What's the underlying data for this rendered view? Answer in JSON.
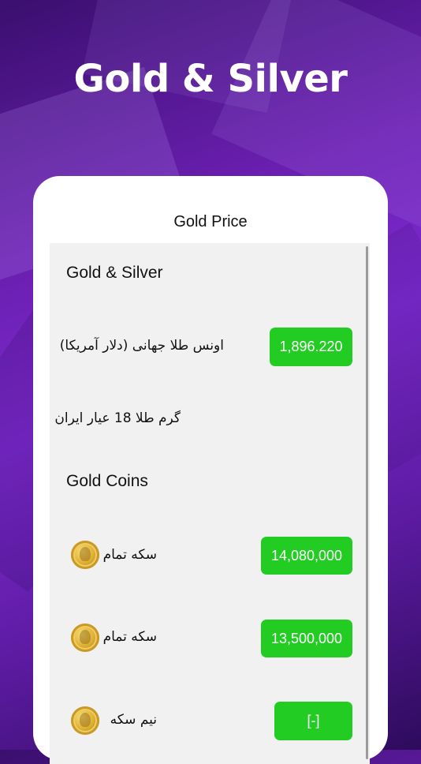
{
  "headline": "Gold & Silver",
  "app_title": "Gold Price",
  "sections": {
    "metals": {
      "title": "Gold & Silver",
      "rows": [
        {
          "label": "اونس طلا جهانی (دلار آمریکا)",
          "price": "1,896.220"
        },
        {
          "label": "گرم طلا 18 عیار ایران",
          "price": ""
        }
      ]
    },
    "coins": {
      "title": "Gold Coins",
      "rows": [
        {
          "label": "سکه تمام",
          "price": "14,080,000",
          "icon": "gold-coin-icon"
        },
        {
          "label": "سکه تمام",
          "price": "13,500,000",
          "icon": "gold-coin-icon"
        },
        {
          "label": "نیم سکه",
          "price": "[-]",
          "icon": "gold-coin-icon"
        }
      ]
    }
  },
  "colors": {
    "price_badge": "#22cc22",
    "background": "#6a1fb0"
  }
}
